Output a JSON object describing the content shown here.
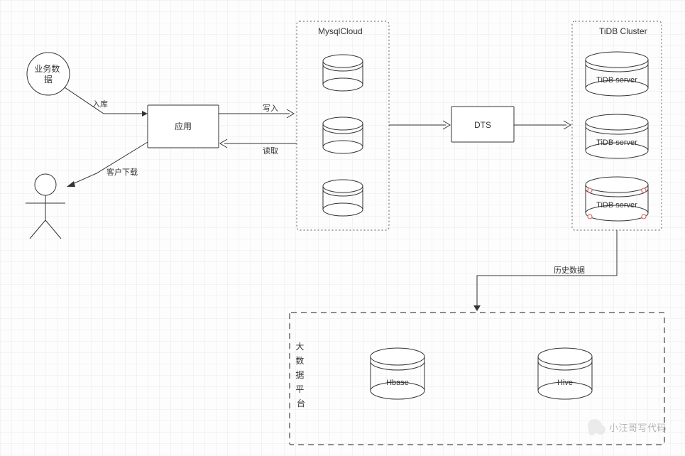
{
  "nodes": {
    "bizData": "业务数\n据",
    "app": "应用",
    "dts": "DTS",
    "hbase": "Hbase",
    "hive": "Hive",
    "tidb1": "TiDB server",
    "tidb2": "TiDB server",
    "tidb3": "TiDB server"
  },
  "containers": {
    "mysqlCloud": "MysqlCloud",
    "tidbCluster": "TiDB Cluster",
    "bigDataPlatform": "大\n数\n据\n平\n台"
  },
  "edges": {
    "bizToApp": "入库",
    "appToMysqlWrite": "写入",
    "mysqlToAppRead": "读取",
    "appToActor": "客户下载",
    "tidbToBigData": "历史数据"
  },
  "watermark": "小汪哥写代码"
}
